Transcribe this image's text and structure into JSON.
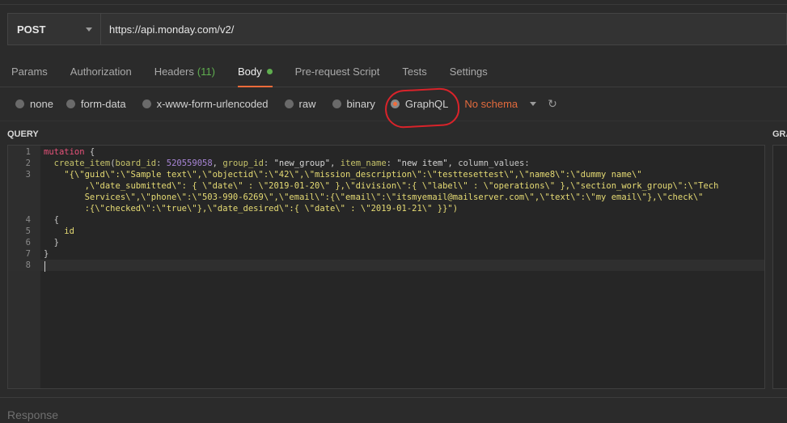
{
  "request": {
    "method": "POST",
    "url": "https://api.monday.com/v2/"
  },
  "tabs": [
    {
      "label": "Params"
    },
    {
      "label": "Authorization"
    },
    {
      "label": "Headers",
      "count": "(11)"
    },
    {
      "label": "Body"
    },
    {
      "label": "Pre-request Script"
    },
    {
      "label": "Tests"
    },
    {
      "label": "Settings"
    }
  ],
  "body_types": [
    "none",
    "form-data",
    "x-www-form-urlencoded",
    "raw",
    "binary",
    "GraphQL"
  ],
  "selected_body_type": "GraphQL",
  "schema": "No schema",
  "query_label": "QUERY",
  "graphql_vars_label": "GRA",
  "response_label": "Response",
  "colors": {
    "accent": "#f26b3a",
    "green": "#5fae4f",
    "annotation": "#d9232a"
  },
  "icons": {
    "refresh": "refresh-icon",
    "caret": "chevron-down-icon"
  },
  "editor": {
    "line_numbers": [
      "1",
      "2",
      "3",
      "",
      "",
      "",
      "4",
      "5",
      "6",
      "7",
      "8"
    ],
    "lines": [
      "mutation {",
      "  create_item(board_id: 520559058, group_id: \"new_group\", item_name: \"new item\", column_values:",
      "    \"{\\\"guid\\\":\\\"Sample text\\\",\\\"objectid\\\":\\\"42\\\",\\\"mission_description\\\":\\\"testtesettest\\\",\\\"name8\\\":\\\"dummy name\\\"",
      "        ,\\\"date_submitted\\\": { \\\"date\\\" : \\\"2019-01-20\\\" },\\\"division\\\":{ \\\"label\\\" : \\\"operations\\\" },\\\"section_work_group\\\":\\\"Tech",
      "        Services\\\",\\\"phone\\\":\\\"503-990-6269\\\",\\\"email\\\":{\\\"email\\\":\\\"itsmyemail@mailserver.com\\\",\\\"text\\\":\\\"my email\\\"},\\\"check\\\"",
      "        :{\\\"checked\\\":\\\"true\\\"},\\\"date_desired\\\":{ \\\"date\\\" : \\\"2019-01-21\\\" }}\")",
      "  {",
      "    id",
      "  }",
      "}",
      ""
    ]
  }
}
